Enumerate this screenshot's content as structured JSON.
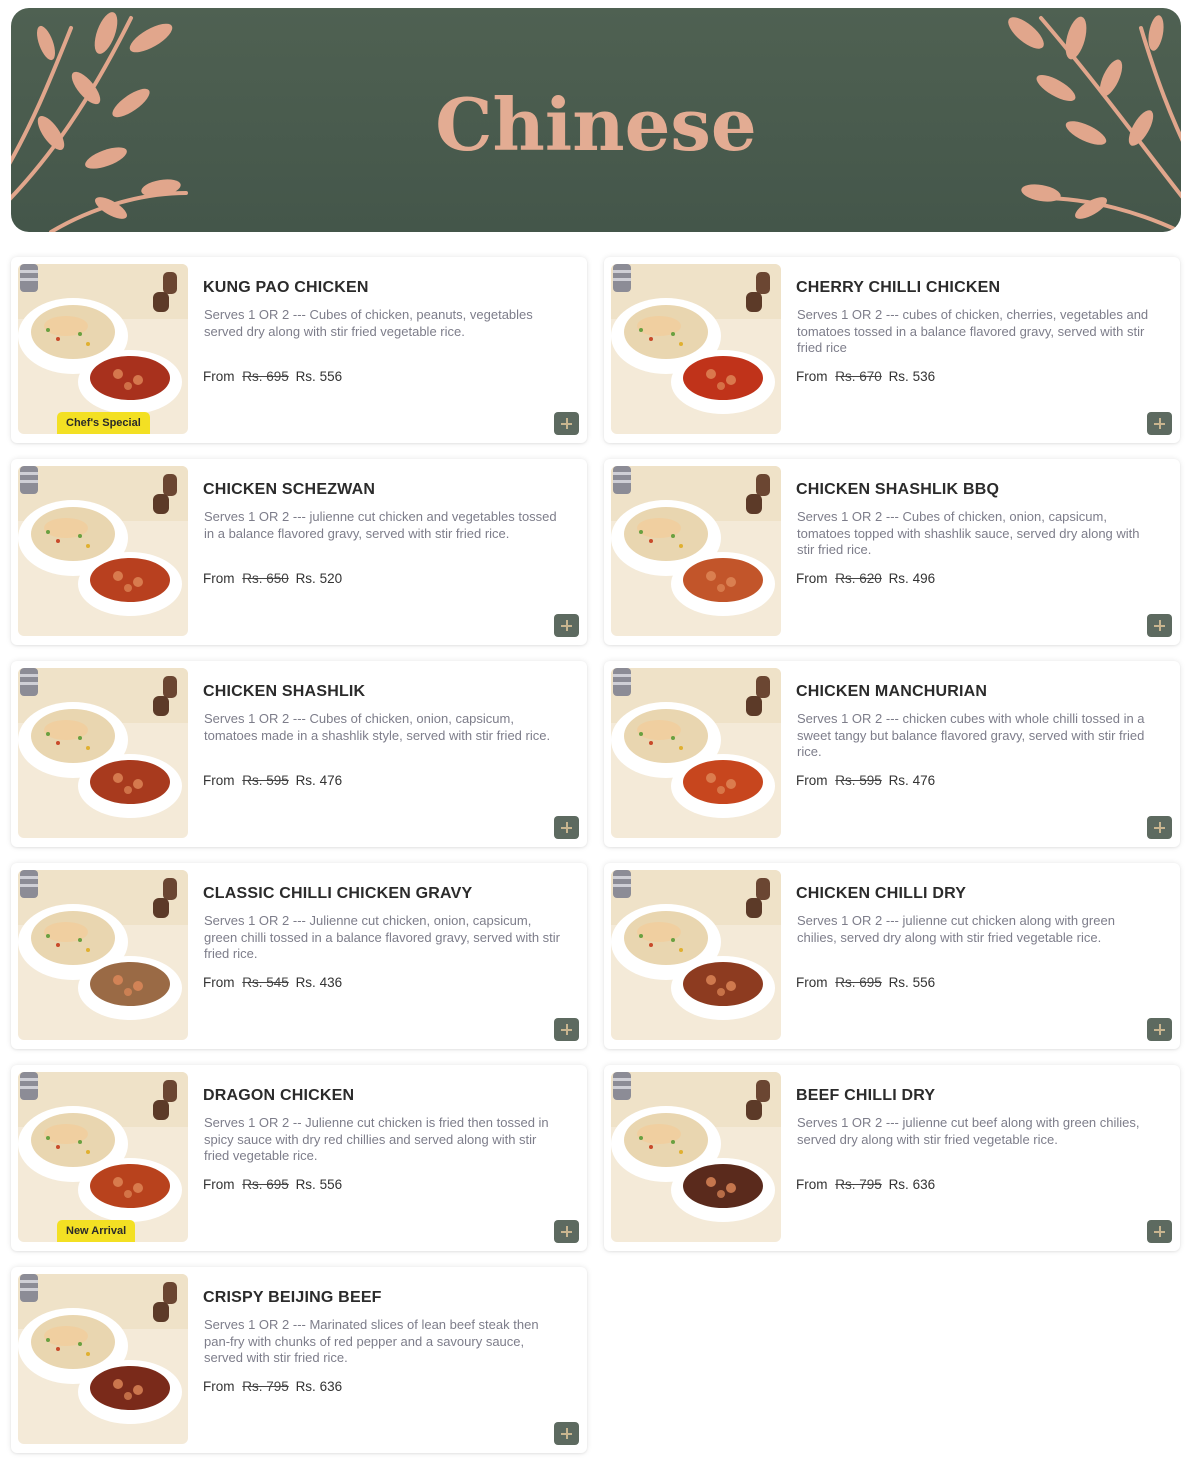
{
  "banner": {
    "title": "Chinese",
    "title_color": "#e3ac93",
    "leaf_color": "#e1a68c",
    "background_color": "#4b5d4f"
  },
  "colors": {
    "add_button": "#5d6a60",
    "badge": "#f3e023",
    "plate_bg": "#f4ead8"
  },
  "price_prefix": "From",
  "items": [
    {
      "name": "KUNG PAO CHICKEN",
      "description": "Serves 1 OR 2 --- Cubes of chicken, peanuts, vegetables served dry along with stir fried vegetable rice.",
      "old_price": "Rs. 695",
      "price": "Rs. 556",
      "badge": "Chef's Special",
      "add_icon": "plus-icon"
    },
    {
      "name": "CHERRY CHILLI CHICKEN",
      "description": "Serves 1 OR 2 --- cubes of chicken, cherries, vegetables and tomatoes tossed in a balance flavored gravy, served with stir fried rice",
      "old_price": "Rs. 670",
      "price": "Rs. 536",
      "badge": "",
      "add_icon": "plus-icon"
    },
    {
      "name": "CHICKEN SCHEZWAN",
      "description": "Serves 1 OR 2 --- julienne cut chicken and vegetables tossed in a balance flavored gravy, served with stir fried rice.",
      "old_price": "Rs. 650",
      "price": "Rs. 520",
      "badge": "",
      "add_icon": "plus-icon"
    },
    {
      "name": "CHICKEN SHASHLIK BBQ",
      "description": "Serves 1 OR 2 --- Cubes of chicken, onion, capsicum, tomatoes topped with shashlik sauce, served dry along with stir fried rice.",
      "old_price": "Rs. 620",
      "price": "Rs. 496",
      "badge": "",
      "add_icon": "plus-icon"
    },
    {
      "name": "CHICKEN SHASHLIK",
      "description": "Serves 1 OR 2 --- Cubes of chicken, onion, capsicum, tomatoes made in a shashlik style, served with stir fried rice.",
      "old_price": "Rs. 595",
      "price": "Rs. 476",
      "badge": "",
      "add_icon": "plus-icon"
    },
    {
      "name": "CHICKEN MANCHURIAN",
      "description": "Serves 1 OR 2 --- chicken cubes with whole chilli tossed in a sweet tangy but balance flavored gravy, served with stir fried rice.",
      "old_price": "Rs. 595",
      "price": "Rs. 476",
      "badge": "",
      "add_icon": "plus-icon"
    },
    {
      "name": "CLASSIC CHILLI CHICKEN GRAVY",
      "description": "Serves 1 OR 2 --- Julienne cut chicken, onion, capsicum, green chilli tossed in a balance flavored gravy, served with stir fried rice.",
      "old_price": "Rs. 545",
      "price": "Rs. 436",
      "badge": "",
      "add_icon": "plus-icon"
    },
    {
      "name": "CHICKEN CHILLI DRY",
      "description": "Serves 1 OR 2 --- julienne cut chicken along with green chilies, served dry along with stir fried vegetable rice.",
      "old_price": "Rs. 695",
      "price": "Rs. 556",
      "badge": "",
      "add_icon": "plus-icon"
    },
    {
      "name": "DRAGON CHICKEN",
      "description": "Serves 1 OR 2 -- Julienne cut chicken is fried then tossed in spicy sauce with dry red chillies and served along with stir fried vegetable rice.",
      "old_price": "Rs. 695",
      "price": "Rs. 556",
      "badge": "New Arrival",
      "add_icon": "plus-icon"
    },
    {
      "name": "BEEF CHILLI DRY",
      "description": "Serves 1 OR 2 --- julienne cut beef along with green chilies, served dry along with stir fried vegetable rice.",
      "old_price": "Rs. 795",
      "price": "Rs. 636",
      "badge": "",
      "add_icon": "plus-icon"
    },
    {
      "name": "CRISPY BEIJING BEEF",
      "description": "Serves 1 OR 2 --- Marinated slices of lean beef steak then pan-fry with chunks of red pepper and a savoury sauce, served with stir fried rice.",
      "old_price": "Rs. 795",
      "price": "Rs. 636",
      "badge": "",
      "add_icon": "plus-icon"
    }
  ]
}
